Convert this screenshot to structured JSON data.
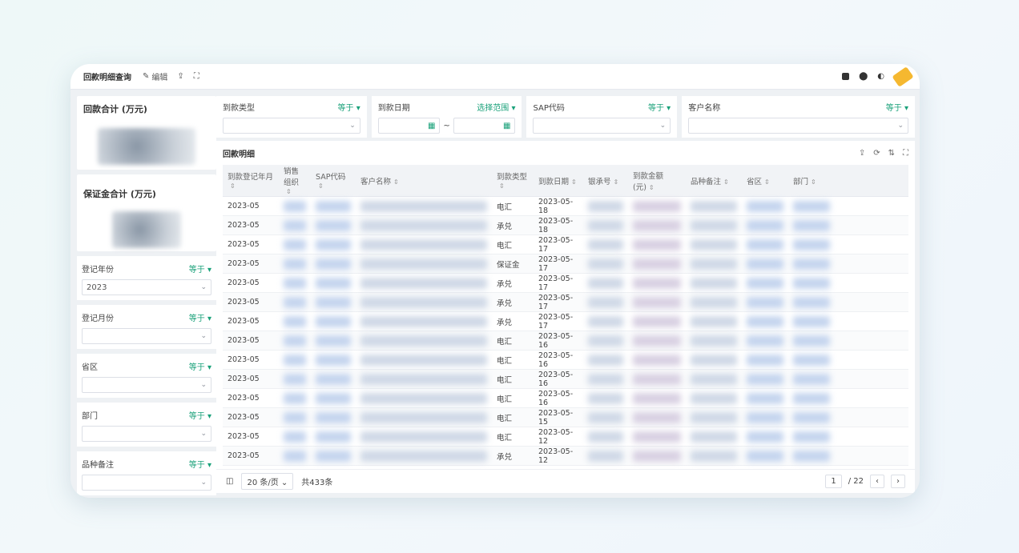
{
  "toolbar": {
    "title": "回款明细查询",
    "edit_label": "编辑"
  },
  "summary": {
    "payment_total_label": "回款合计 (万元)",
    "deposit_total_label": "保证金合计 (万元)"
  },
  "left_filters": [
    {
      "label": "登记年份",
      "op": "等于",
      "value": "2023"
    },
    {
      "label": "登记月份",
      "op": "等于",
      "value": ""
    },
    {
      "label": "省区",
      "op": "等于",
      "value": ""
    },
    {
      "label": "部门",
      "op": "等于",
      "value": ""
    },
    {
      "label": "品种备注",
      "op": "等于",
      "value": ""
    }
  ],
  "top_filters": {
    "type": {
      "label": "到款类型",
      "op": "等于"
    },
    "date": {
      "label": "到款日期",
      "op": "选择范围",
      "sep": "~"
    },
    "sap": {
      "label": "SAP代码",
      "op": "等于"
    },
    "customer": {
      "label": "客户名称",
      "op": "等于"
    }
  },
  "table": {
    "title": "回款明细",
    "columns": [
      "到款登记年月",
      "销售组织",
      "SAP代码",
      "客户名称",
      "到款类型",
      "到款日期",
      "银承号",
      "到款金额(元)",
      "品种备注",
      "省区",
      "部门"
    ],
    "rows": [
      {
        "month": "2023-05",
        "type": "电汇",
        "date": "2023-05-18"
      },
      {
        "month": "2023-05",
        "type": "承兑",
        "date": "2023-05-18"
      },
      {
        "month": "2023-05",
        "type": "电汇",
        "date": "2023-05-17"
      },
      {
        "month": "2023-05",
        "type": "保证金",
        "date": "2023-05-17"
      },
      {
        "month": "2023-05",
        "type": "承兑",
        "date": "2023-05-17"
      },
      {
        "month": "2023-05",
        "type": "承兑",
        "date": "2023-05-17"
      },
      {
        "month": "2023-05",
        "type": "承兑",
        "date": "2023-05-17"
      },
      {
        "month": "2023-05",
        "type": "电汇",
        "date": "2023-05-16"
      },
      {
        "month": "2023-05",
        "type": "电汇",
        "date": "2023-05-16"
      },
      {
        "month": "2023-05",
        "type": "电汇",
        "date": "2023-05-16"
      },
      {
        "month": "2023-05",
        "type": "电汇",
        "date": "2023-05-16"
      },
      {
        "month": "2023-05",
        "type": "电汇",
        "date": "2023-05-15"
      },
      {
        "month": "2023-05",
        "type": "电汇",
        "date": "2023-05-12"
      },
      {
        "month": "2023-05",
        "type": "承兑",
        "date": "2023-05-12"
      }
    ]
  },
  "footer": {
    "page_size": "20 条/页",
    "total": "共433条",
    "current_page": "1",
    "page_count": "/ 22"
  }
}
